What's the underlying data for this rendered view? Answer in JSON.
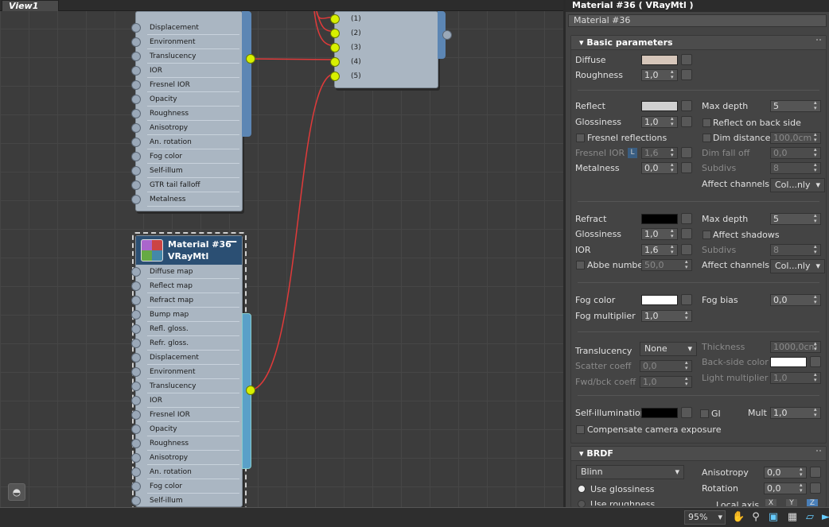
{
  "view": {
    "tab": "View1"
  },
  "node_top": {
    "rows": [
      "Displacement",
      "Environment",
      "Translucency",
      "IOR",
      "Fresnel IOR",
      "Opacity",
      "Roughness",
      "Anisotropy",
      "An. rotation",
      "Fog color",
      "Self-illum",
      "GTR tail falloff",
      "Metalness"
    ]
  },
  "node_small": {
    "rows": [
      "(1)",
      "(2)",
      "(3)",
      "(4)",
      "(5)"
    ]
  },
  "node_mat": {
    "title": "Material #36",
    "subtitle": "VRayMtl",
    "collapse": "—",
    "rows": [
      "Diffuse map",
      "Reflect map",
      "Refract map",
      "Bump map",
      "Refl. gloss.",
      "Refr. gloss.",
      "Displacement",
      "Environment",
      "Translucency",
      "IOR",
      "Fresnel IOR",
      "Opacity",
      "Roughness",
      "Anisotropy",
      "An. rotation",
      "Fog color",
      "Self-illum"
    ]
  },
  "panel": {
    "title": "Material #36  ( VRayMtl )",
    "name": "Material #36"
  },
  "basic": {
    "header": "Basic parameters",
    "diffuse": "Diffuse",
    "roughness": "Roughness",
    "roughness_val": "1,0",
    "reflect": "Reflect",
    "glossiness": "Glossiness",
    "glossiness_val": "1,0",
    "fresnel": "Fresnel reflections",
    "fresnel_ior": "Fresnel IOR",
    "fresnel_l": "L",
    "fresnel_ior_val": "1,6",
    "metalness": "Metalness",
    "metalness_val": "0,0",
    "max_depth": "Max depth",
    "max_depth_val": "5",
    "reflect_back": "Reflect on back side",
    "dim_distance": "Dim distance",
    "dim_distance_val": "100,0cm",
    "dim_falloff": "Dim fall off",
    "dim_falloff_val": "0,0",
    "subdivs": "Subdivs",
    "subdivs_val": "8",
    "affect_channels": "Affect channels",
    "affect_channels_val": "Col...nly",
    "refract": "Refract",
    "r_gloss": "Glossiness",
    "r_gloss_val": "1,0",
    "ior": "IOR",
    "ior_val": "1,6",
    "abbe": "Abbe number",
    "abbe_val": "50,0",
    "r_max_depth": "Max depth",
    "r_max_depth_val": "5",
    "affect_shadows": "Affect shadows",
    "r_subdivs": "Subdivs",
    "r_subdivs_val": "8",
    "r_affect_channels": "Affect channels",
    "r_affect_channels_val": "Col...nly",
    "fog_color": "Fog color",
    "fog_bias": "Fog bias",
    "fog_bias_val": "0,0",
    "fog_mult": "Fog multiplier",
    "fog_mult_val": "1,0",
    "translucency": "Translucency",
    "translucency_val": "None",
    "thickness": "Thickness",
    "thickness_val": "1000,0cm",
    "scatter": "Scatter coeff",
    "scatter_val": "0,0",
    "backside": "Back-side color",
    "fwd": "Fwd/bck coeff",
    "fwd_val": "1,0",
    "light_mult": "Light multiplier",
    "light_mult_val": "1,0",
    "selfillum": "Self-illumination",
    "gi": "GI",
    "mult": "Mult",
    "mult_val": "1,0",
    "compensate": "Compensate camera exposure"
  },
  "brdf": {
    "header": "BRDF",
    "type": "Blinn",
    "anisotropy": "Anisotropy",
    "anisotropy_val": "0,0",
    "rotation": "Rotation",
    "rotation_val": "0,0",
    "use_gloss": "Use glossiness",
    "use_rough": "Use roughness",
    "local_axis": "Local axis",
    "x": "X",
    "y": "Y",
    "z": "Z"
  },
  "status": {
    "zoom": "95%"
  },
  "colors": {
    "diffuse": "#d6c6ba",
    "reflect": "#d0d0d0",
    "refract": "#000000",
    "fog": "#ffffff",
    "selfillum": "#000000",
    "backside": "#ffffff",
    "wire": "#e03a3a"
  }
}
